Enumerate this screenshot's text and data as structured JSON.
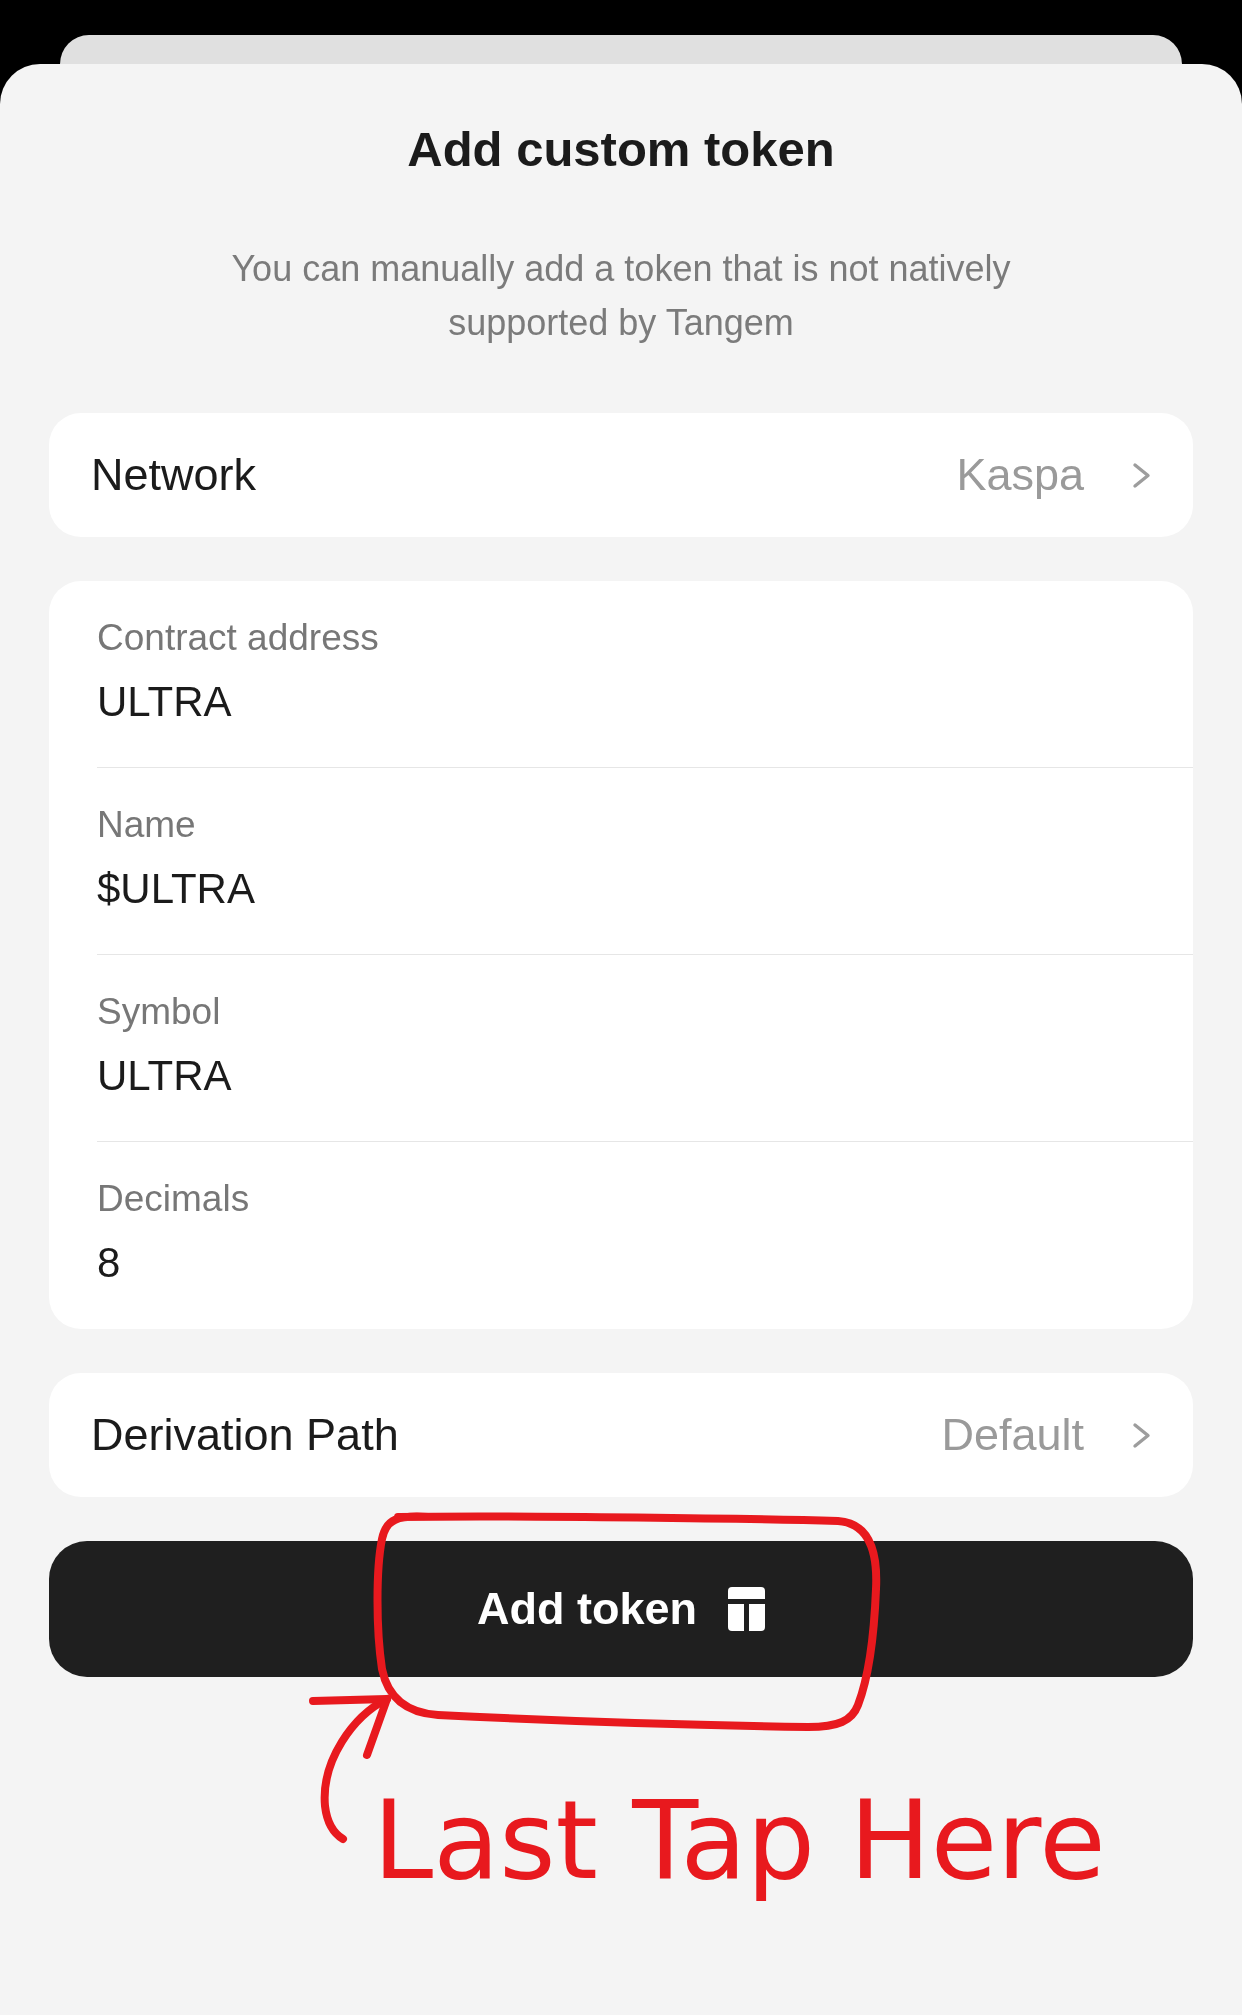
{
  "sheet": {
    "title": "Add custom token",
    "subtitle": "You can manually add a token that is not natively supported by Tangem"
  },
  "network": {
    "label": "Network",
    "value": "Kaspa"
  },
  "fields": [
    {
      "label": "Contract address",
      "value": "ULTRA"
    },
    {
      "label": "Name",
      "value": "$ULTRA"
    },
    {
      "label": "Symbol",
      "value": "ULTRA"
    },
    {
      "label": "Decimals",
      "value": "8"
    }
  ],
  "derivation_path": {
    "label": "Derivation Path",
    "value": "Default"
  },
  "button": {
    "label": "Add token"
  },
  "annotation": {
    "text": "Last Tap Here"
  }
}
